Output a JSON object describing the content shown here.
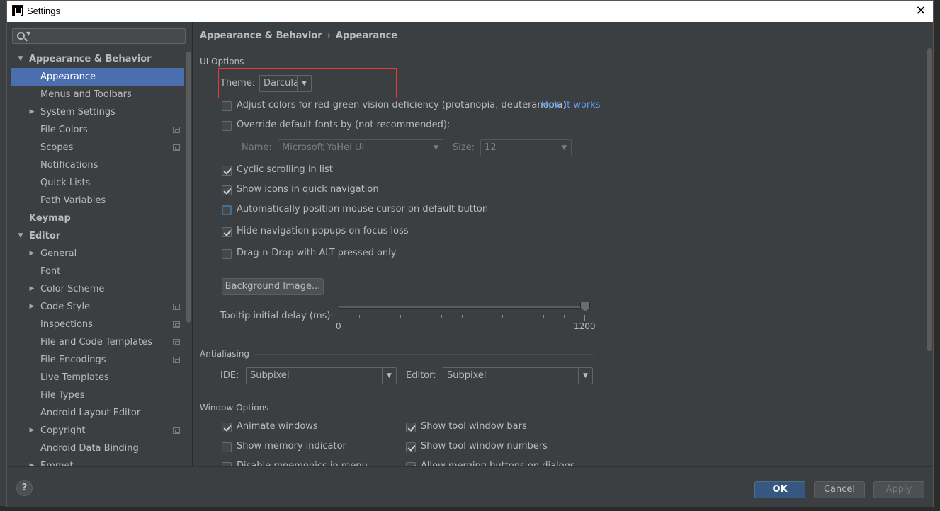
{
  "window": {
    "title": "Settings",
    "close_glyph": "✕"
  },
  "sidebar": {
    "search": {
      "value": "",
      "placeholder": ""
    },
    "items": [
      {
        "label": "Appearance & Behavior",
        "level": 0,
        "expandable": true,
        "expanded": true,
        "bold": true
      },
      {
        "label": "Appearance",
        "level": 1,
        "selected": true
      },
      {
        "label": "Menus and Toolbars",
        "level": 1
      },
      {
        "label": "System Settings",
        "level": 1,
        "expandable": true
      },
      {
        "label": "File Colors",
        "level": 1,
        "project_icon": true
      },
      {
        "label": "Scopes",
        "level": 1,
        "project_icon": true
      },
      {
        "label": "Notifications",
        "level": 1
      },
      {
        "label": "Quick Lists",
        "level": 1
      },
      {
        "label": "Path Variables",
        "level": 1
      },
      {
        "label": "Keymap",
        "level": 0,
        "bold": true
      },
      {
        "label": "Editor",
        "level": 0,
        "expandable": true,
        "expanded": true,
        "bold": true
      },
      {
        "label": "General",
        "level": 1,
        "expandable": true
      },
      {
        "label": "Font",
        "level": 1
      },
      {
        "label": "Color Scheme",
        "level": 1,
        "expandable": true
      },
      {
        "label": "Code Style",
        "level": 1,
        "expandable": true,
        "project_icon": true
      },
      {
        "label": "Inspections",
        "level": 1,
        "project_icon": true
      },
      {
        "label": "File and Code Templates",
        "level": 1,
        "project_icon": true
      },
      {
        "label": "File Encodings",
        "level": 1,
        "project_icon": true
      },
      {
        "label": "Live Templates",
        "level": 1
      },
      {
        "label": "File Types",
        "level": 1
      },
      {
        "label": "Android Layout Editor",
        "level": 1
      },
      {
        "label": "Copyright",
        "level": 1,
        "expandable": true,
        "project_icon": true
      },
      {
        "label": "Android Data Binding",
        "level": 1
      },
      {
        "label": "Emmet",
        "level": 1,
        "expandable": true
      }
    ]
  },
  "breadcrumb": {
    "parent": "Appearance & Behavior",
    "separator": "›",
    "current": "Appearance"
  },
  "ui_options": {
    "section_title": "UI Options",
    "theme_label": "Theme:",
    "theme_value": "Darcula",
    "adjust_colors": {
      "label": "Adjust colors for red-green vision deficiency (protanopia, deuteranopia)",
      "checked": false
    },
    "how_it_works": "How it works",
    "override_fonts": {
      "label": "Override default fonts by (not recommended):",
      "checked": false
    },
    "font_name_label": "Name:",
    "font_name_value": "Microsoft YaHei UI",
    "font_size_label": "Size:",
    "font_size_value": "12",
    "cyclic_scrolling": {
      "label": "Cyclic scrolling in list",
      "checked": true
    },
    "show_icons": {
      "label": "Show icons in quick navigation",
      "checked": true
    },
    "auto_position_mouse": {
      "label": "Automatically position mouse cursor on default button",
      "checked": false
    },
    "hide_nav_popups": {
      "label": "Hide navigation popups on focus loss",
      "checked": true
    },
    "drag_n_drop": {
      "label": "Drag-n-Drop with ALT pressed only",
      "checked": false
    },
    "background_image_button": "Background Image...",
    "tooltip_delay_label": "Tooltip initial delay (ms):",
    "tooltip_delay": {
      "min": "0",
      "max": "1200",
      "value": 1200
    }
  },
  "antialiasing": {
    "section_title": "Antialiasing",
    "ide_label": "IDE:",
    "ide_value": "Subpixel",
    "editor_label": "Editor:",
    "editor_value": "Subpixel"
  },
  "window_options": {
    "section_title": "Window Options",
    "animate_windows": {
      "label": "Animate windows",
      "checked": true
    },
    "show_memory": {
      "label": "Show memory indicator",
      "checked": false
    },
    "disable_mnemonics": {
      "label": "Disable mnemonics in menu",
      "checked": false
    },
    "show_tool_window_bars": {
      "label": "Show tool window bars",
      "checked": true
    },
    "show_tool_window_numbers": {
      "label": "Show tool window numbers",
      "checked": true
    },
    "allow_merging_buttons": {
      "label": "Allow merging buttons on dialogs",
      "checked": true
    }
  },
  "footer": {
    "help": "?",
    "ok": "OK",
    "cancel": "Cancel",
    "apply": "Apply"
  },
  "colors": {
    "selection": "#4b6eaf",
    "link": "#589df6",
    "highlight_box": "#e23a3a",
    "ok_button": "#365880"
  }
}
